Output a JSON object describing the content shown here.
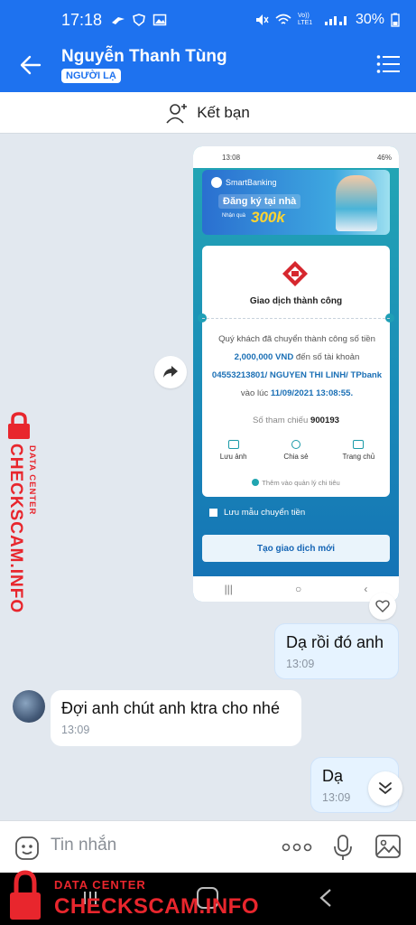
{
  "status_bar": {
    "time": "17:18",
    "battery": "30%",
    "network_label": "Vo)) LTE1"
  },
  "header": {
    "contact_name": "Nguyễn Thanh Tùng",
    "badge": "NGƯỜI LẠ"
  },
  "add_friend": {
    "label": "Kết bạn"
  },
  "shared_image": {
    "phone_time": "13:08",
    "phone_battery": "46%",
    "banner": {
      "brand": "SmartBanking",
      "headline": "Đăng ký tại nhà",
      "gift_label": "Nhận quà",
      "gift_amount": "300k"
    },
    "receipt": {
      "status": "Giao dịch thành công",
      "desc_prefix": "Quý khách đã chuyển thành công số tiền",
      "amount": "2,000,000 VND",
      "desc_mid": "đến số tài khoản",
      "account": "04553213801/ NGUYEN THI LINH/ TPbank",
      "desc_time_prefix": "vào lúc",
      "datetime": "11/09/2021 13:08:55.",
      "ref_label": "Số tham chiếu",
      "ref_number": "900193",
      "actions": [
        "Lưu ảnh",
        "Chia sẻ",
        "Trang chủ"
      ],
      "manage_label": "Thêm vào quản lý chi tiêu"
    },
    "save_template": "Lưu mẫu chuyển tiền",
    "new_transaction": "Tạo giao dịch mới"
  },
  "messages": [
    {
      "direction": "sent",
      "text": "Dạ rồi đó anh",
      "time": "13:09"
    },
    {
      "direction": "received",
      "text": "Đợi anh chút anh ktra cho nhé",
      "time": "13:09"
    },
    {
      "direction": "sent",
      "text": "Dạ",
      "time": "13:09"
    }
  ],
  "composer": {
    "placeholder": "Tin nhắn"
  },
  "watermark": {
    "side_text": "CHECKSCAM.INFO",
    "side_sub": "DATA CENTER",
    "bottom_sub": "DATA CENTER",
    "bottom_text": "CHECKSCAM.INFO"
  },
  "colors": {
    "header_blue": "#1e72ef",
    "sent_bubble": "#e6f3ff",
    "watermark_red": "#e8262d"
  }
}
